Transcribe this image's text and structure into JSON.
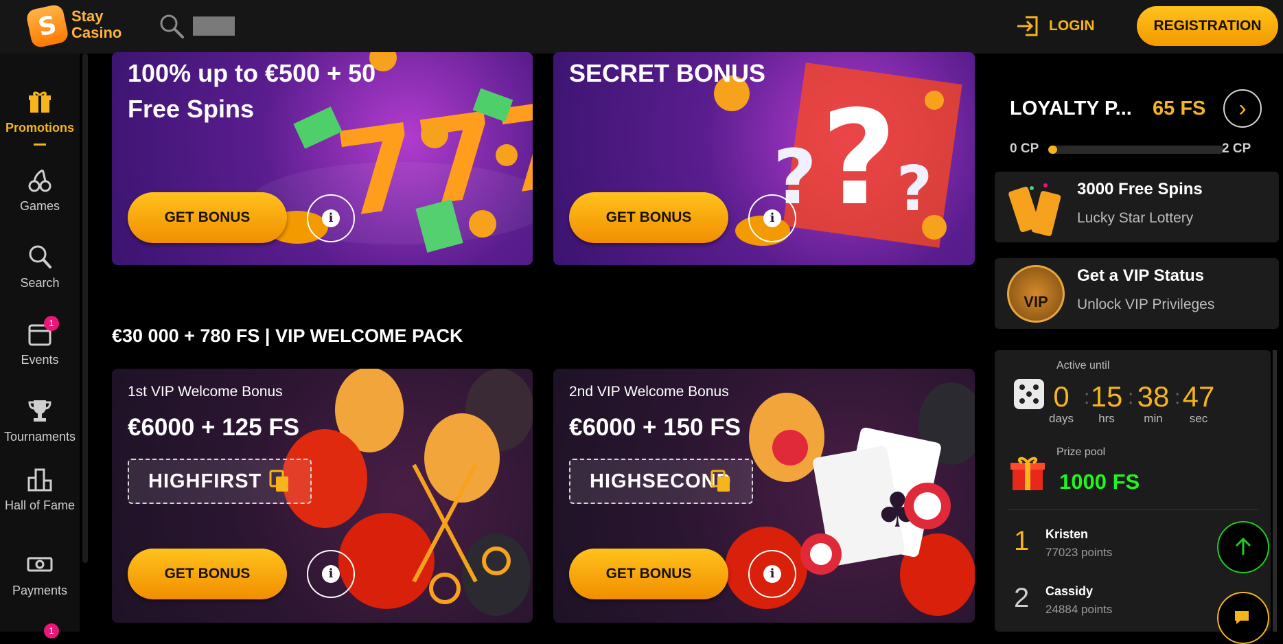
{
  "header": {
    "logo_text_1": "Stay",
    "logo_text_2": "Casino",
    "logo_mark": "S",
    "login_label": "LOGIN",
    "registration_label": "REGISTRATION"
  },
  "sidebar": {
    "items": [
      {
        "label": "Promotions",
        "icon": "gift-icon",
        "active": true
      },
      {
        "label": "Games",
        "icon": "cherries-icon"
      },
      {
        "label": "Search",
        "icon": "search-icon"
      },
      {
        "label": "Events",
        "icon": "calendar-icon",
        "badge": "1"
      },
      {
        "label": "Tournaments",
        "icon": "trophy-icon"
      },
      {
        "label": "Hall of Fame",
        "icon": "podium-icon"
      },
      {
        "label": "Payments",
        "icon": "banknote-icon"
      }
    ],
    "extra_badge": "1"
  },
  "promos_top": [
    {
      "title_line1": "100% up to €500 + 50",
      "title_line2": "Free Spins",
      "button": "GET BONUS",
      "info": "i"
    },
    {
      "title_line1": "SECRET BONUS",
      "button": "GET BONUS",
      "info": "i"
    }
  ],
  "vip_section": {
    "title": "€30 000 + 780 FS | VIP WELCOME PACK",
    "cards": [
      {
        "subtitle": "1st VIP Welcome Bonus",
        "amount": "€6000 + 125 FS",
        "code": "HIGHFIRST",
        "button": "GET BONUS",
        "info": "i"
      },
      {
        "subtitle": "2nd VIP Welcome Bonus",
        "amount": "€6000 + 150 FS",
        "code": "HIGHSECOND",
        "button": "GET BONUS",
        "info": "i"
      }
    ]
  },
  "loyalty": {
    "title": "LOYALTY P...",
    "free_spins": "65 FS",
    "cp_min": "0 CP",
    "cp_max": "2 CP",
    "progress_fraction": 0.05
  },
  "lottery": {
    "title": "3000 Free Spins",
    "subtitle": "Lucky Star Lottery"
  },
  "vip_status": {
    "title": "Get a VIP Status",
    "subtitle": "Unlock VIP Privileges",
    "badge_text": "VIP"
  },
  "tournament": {
    "active_until_label": "Active until",
    "countdown": [
      {
        "value": "0",
        "unit": "days"
      },
      {
        "value": "15",
        "unit": "hrs"
      },
      {
        "value": "38",
        "unit": "min"
      },
      {
        "value": "47",
        "unit": "sec"
      }
    ],
    "prize_pool_label": "Prize pool",
    "prize_pool_value": "1000 FS",
    "leaders": [
      {
        "rank": "1",
        "name": "Kristen",
        "points": "77023 points"
      },
      {
        "rank": "2",
        "name": "Cassidy",
        "points": "24884 points"
      }
    ]
  },
  "colors": {
    "accent": "#f6b51c",
    "prize_green": "#1ff51f",
    "badge_pink": "#e8177a"
  }
}
